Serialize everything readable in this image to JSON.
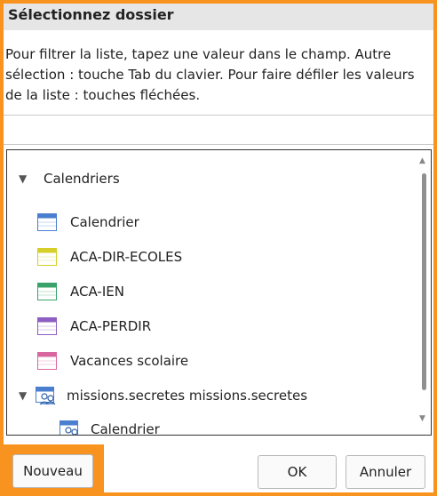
{
  "dialog": {
    "title": "Sélectionnez dossier",
    "instructions": "Pour filtrer la liste, tapez une valeur dans le champ. Autre sélection : touche Tab du clavier. Pour faire défiler les valeurs de la liste : touches fléchées.",
    "filter_value": ""
  },
  "tree": {
    "root_label": "Calendriers",
    "items": [
      {
        "label": "Calendrier",
        "color": "#4a7fcf"
      },
      {
        "label": "ACA-DIR-ECOLES",
        "color": "#d6cf2a"
      },
      {
        "label": "ACA-IEN",
        "color": "#3aa36b"
      },
      {
        "label": "ACA-PERDIR",
        "color": "#8e5fc2"
      },
      {
        "label": "Vacances scolaire",
        "color": "#d8679f"
      }
    ],
    "shared_folder": {
      "label": "missions.secretes missions.secretes",
      "icon": "shared-calendar-icon"
    },
    "shared_child": {
      "label": "Calendrier",
      "icon": "shared-calendar-icon"
    }
  },
  "buttons": {
    "new_label": "Nouveau",
    "ok_label": "OK",
    "cancel_label": "Annuler"
  },
  "colors": {
    "frame": "#f7931e",
    "title_bg": "#e6e6e6"
  }
}
